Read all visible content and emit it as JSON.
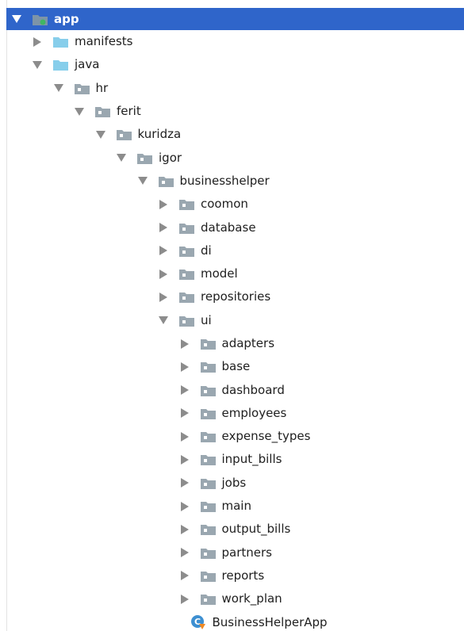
{
  "tree": {
    "root": {
      "label": "app",
      "icon": "module-folder-icon",
      "expanded": true,
      "selected": true
    },
    "items": [
      {
        "label": "manifests",
        "depth": 1,
        "expanded": false,
        "icon": "source-folder-icon",
        "kind": "folder"
      },
      {
        "label": "java",
        "depth": 1,
        "expanded": true,
        "icon": "source-folder-icon",
        "kind": "folder"
      },
      {
        "label": "hr",
        "depth": 2,
        "expanded": true,
        "icon": "package-icon",
        "kind": "package"
      },
      {
        "label": "ferit",
        "depth": 3,
        "expanded": true,
        "icon": "package-icon",
        "kind": "package"
      },
      {
        "label": "kuridza",
        "depth": 4,
        "expanded": true,
        "icon": "package-icon",
        "kind": "package"
      },
      {
        "label": "igor",
        "depth": 5,
        "expanded": true,
        "icon": "package-icon",
        "kind": "package"
      },
      {
        "label": "businesshelper",
        "depth": 6,
        "expanded": true,
        "icon": "package-icon",
        "kind": "package"
      },
      {
        "label": "coomon",
        "depth": 7,
        "expanded": false,
        "icon": "package-icon",
        "kind": "package"
      },
      {
        "label": "database",
        "depth": 7,
        "expanded": false,
        "icon": "package-icon",
        "kind": "package"
      },
      {
        "label": "di",
        "depth": 7,
        "expanded": false,
        "icon": "package-icon",
        "kind": "package"
      },
      {
        "label": "model",
        "depth": 7,
        "expanded": false,
        "icon": "package-icon",
        "kind": "package"
      },
      {
        "label": "repositories",
        "depth": 7,
        "expanded": false,
        "icon": "package-icon",
        "kind": "package"
      },
      {
        "label": "ui",
        "depth": 7,
        "expanded": true,
        "icon": "package-icon",
        "kind": "package"
      },
      {
        "label": "adapters",
        "depth": 8,
        "expanded": false,
        "icon": "package-icon",
        "kind": "package"
      },
      {
        "label": "base",
        "depth": 8,
        "expanded": false,
        "icon": "package-icon",
        "kind": "package"
      },
      {
        "label": "dashboard",
        "depth": 8,
        "expanded": false,
        "icon": "package-icon",
        "kind": "package"
      },
      {
        "label": "employees",
        "depth": 8,
        "expanded": false,
        "icon": "package-icon",
        "kind": "package"
      },
      {
        "label": "expense_types",
        "depth": 8,
        "expanded": false,
        "icon": "package-icon",
        "kind": "package"
      },
      {
        "label": "input_bills",
        "depth": 8,
        "expanded": false,
        "icon": "package-icon",
        "kind": "package"
      },
      {
        "label": "jobs",
        "depth": 8,
        "expanded": false,
        "icon": "package-icon",
        "kind": "package"
      },
      {
        "label": "main",
        "depth": 8,
        "expanded": false,
        "icon": "package-icon",
        "kind": "package"
      },
      {
        "label": "output_bills",
        "depth": 8,
        "expanded": false,
        "icon": "package-icon",
        "kind": "package"
      },
      {
        "label": "partners",
        "depth": 8,
        "expanded": false,
        "icon": "package-icon",
        "kind": "package"
      },
      {
        "label": "reports",
        "depth": 8,
        "expanded": false,
        "icon": "package-icon",
        "kind": "package"
      },
      {
        "label": "work_plan",
        "depth": 8,
        "expanded": false,
        "icon": "package-icon",
        "kind": "package"
      },
      {
        "label": "BusinessHelperApp",
        "depth": 8,
        "expanded": null,
        "icon": "kotlin-class-icon",
        "kind": "class"
      }
    ]
  },
  "colors": {
    "selection": "#2f65ca",
    "arrow": "#8c8c8c",
    "source_folder": "#87ceeb",
    "package_folder": "#9aa7b0",
    "module_dot": "#40b663"
  }
}
